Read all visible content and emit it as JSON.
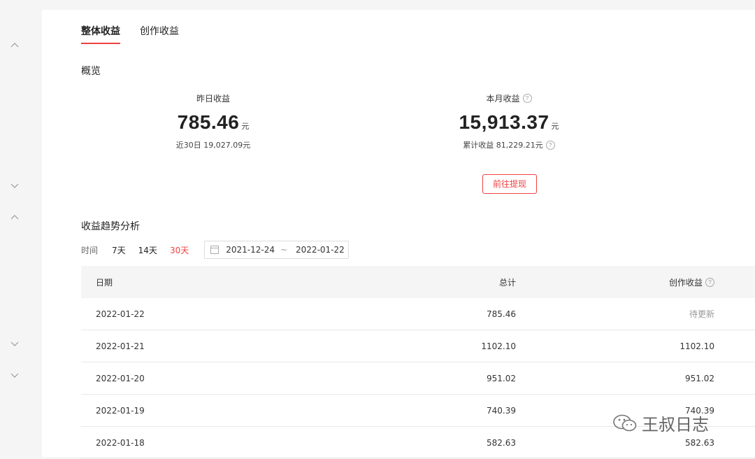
{
  "tabs": [
    {
      "label": "整体收益",
      "active": true
    },
    {
      "label": "创作收益",
      "active": false
    }
  ],
  "overview": {
    "title": "概览",
    "yesterday": {
      "label": "昨日收益",
      "value": "785.46",
      "unit": "元",
      "sub": "近30日 19,027.09元"
    },
    "month": {
      "label": "本月收益",
      "value": "15,913.37",
      "unit": "元",
      "sub": "累计收益 81,229.21元"
    },
    "withdraw_label": "前往提现"
  },
  "trend": {
    "title": "收益趋势分析",
    "time_label": "时间",
    "ranges": [
      "7天",
      "14天",
      "30天"
    ],
    "active_range": "30天",
    "date_start": "2021-12-24",
    "date_sep": "~",
    "date_end": "2022-01-22"
  },
  "table": {
    "headers": {
      "date": "日期",
      "total": "总计",
      "create": "创作收益"
    },
    "rows": [
      {
        "date": "2022-01-22",
        "total": "785.46",
        "create": "待更新"
      },
      {
        "date": "2022-01-21",
        "total": "1102.10",
        "create": "1102.10"
      },
      {
        "date": "2022-01-20",
        "total": "951.02",
        "create": "951.02"
      },
      {
        "date": "2022-01-19",
        "total": "740.39",
        "create": "740.39"
      },
      {
        "date": "2022-01-18",
        "total": "582.63",
        "create": "582.63"
      }
    ]
  },
  "watermark": {
    "text": "王叔日志"
  },
  "colors": {
    "accent": "#f04142",
    "page_bg": "#f5f5f5",
    "header_bg": "#f5f5f5"
  },
  "icons": [
    "chevron-up-icon",
    "chevron-down-icon",
    "help-icon",
    "calendar-icon",
    "wechat-logo"
  ]
}
